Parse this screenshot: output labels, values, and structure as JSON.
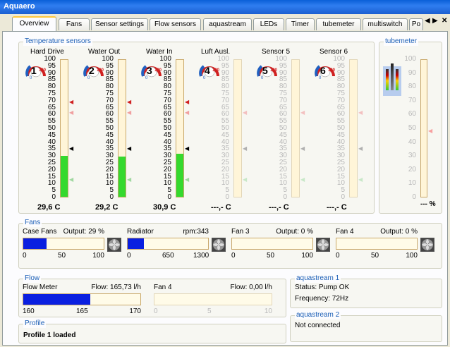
{
  "window": {
    "title": "Aquaero"
  },
  "tabs": [
    {
      "label": "Overview"
    },
    {
      "label": "Fans"
    },
    {
      "label": "Sensor settings"
    },
    {
      "label": "Flow sensors"
    },
    {
      "label": "aquastream"
    },
    {
      "label": "LEDs"
    },
    {
      "label": "Timer"
    },
    {
      "label": "tubemeter"
    },
    {
      "label": "multiswitch"
    },
    {
      "label": "Po"
    }
  ],
  "temperature": {
    "group_title": "Temperature sensors",
    "scale": [
      "100",
      "95",
      "90",
      "85",
      "80",
      "75",
      "70",
      "65",
      "60",
      "55",
      "50",
      "45",
      "40",
      "35",
      "30",
      "25",
      "20",
      "15",
      "10",
      "5",
      "0"
    ],
    "sensors": [
      {
        "name": "Hard Drive",
        "number": "1",
        "value": "29,6 C",
        "fill": 0.296,
        "active": true
      },
      {
        "name": "Water Out",
        "number": "2",
        "value": "29,2 C",
        "fill": 0.292,
        "active": true
      },
      {
        "name": "Water In",
        "number": "3",
        "value": "30,9 C",
        "fill": 0.309,
        "active": true
      },
      {
        "name": "Luft Ausl.",
        "number": "4",
        "value": "---,- C",
        "fill": 0,
        "active": false
      },
      {
        "name": "Sensor 5",
        "number": "5",
        "value": "---,- C",
        "fill": 0,
        "active": false
      },
      {
        "name": "Sensor 6",
        "number": "6",
        "value": "---,- C",
        "fill": 0,
        "active": false
      }
    ],
    "gauge_labels": {
      "min": "0",
      "max": "100"
    }
  },
  "tubemeter": {
    "group_title": "tubemeter",
    "value": "--- %"
  },
  "fans": {
    "group_title": "Fans",
    "items": [
      {
        "name": "Case Fans",
        "readout": "Output: 29 %",
        "fill": 0.29,
        "ticks": [
          "0",
          "50",
          "100"
        ]
      },
      {
        "name": "Radiator",
        "readout": "rpm:343",
        "fill": 0.2,
        "ticks": [
          "0",
          "650",
          "1300"
        ]
      },
      {
        "name": "Fan 3",
        "readout": "Output: 0 %",
        "fill": 0,
        "ticks": [
          "0",
          "50",
          "100"
        ]
      },
      {
        "name": "Fan 4",
        "readout": "Output: 0 %",
        "fill": 0,
        "ticks": [
          "0",
          "50",
          "100"
        ]
      }
    ]
  },
  "flow": {
    "group_title": "Flow",
    "meters": [
      {
        "name": "Flow Meter",
        "readout": "Flow: 165,73 l/h",
        "fill": 0.57,
        "ticks": [
          "160",
          "165",
          "170"
        ],
        "active": true
      },
      {
        "name": "Fan 4",
        "readout": "Flow: 0,00 l/h",
        "fill": 0,
        "ticks": [
          "0",
          "5",
          "10"
        ],
        "active": false
      }
    ]
  },
  "aquastream1": {
    "title": "aquastream 1",
    "status": "Status: Pump OK",
    "frequency": "Frequency: 72Hz"
  },
  "aquastream2": {
    "title": "aquastream 2",
    "status": "Not connected"
  },
  "profile": {
    "title": "Profile",
    "status": "Profile 1 loaded"
  }
}
